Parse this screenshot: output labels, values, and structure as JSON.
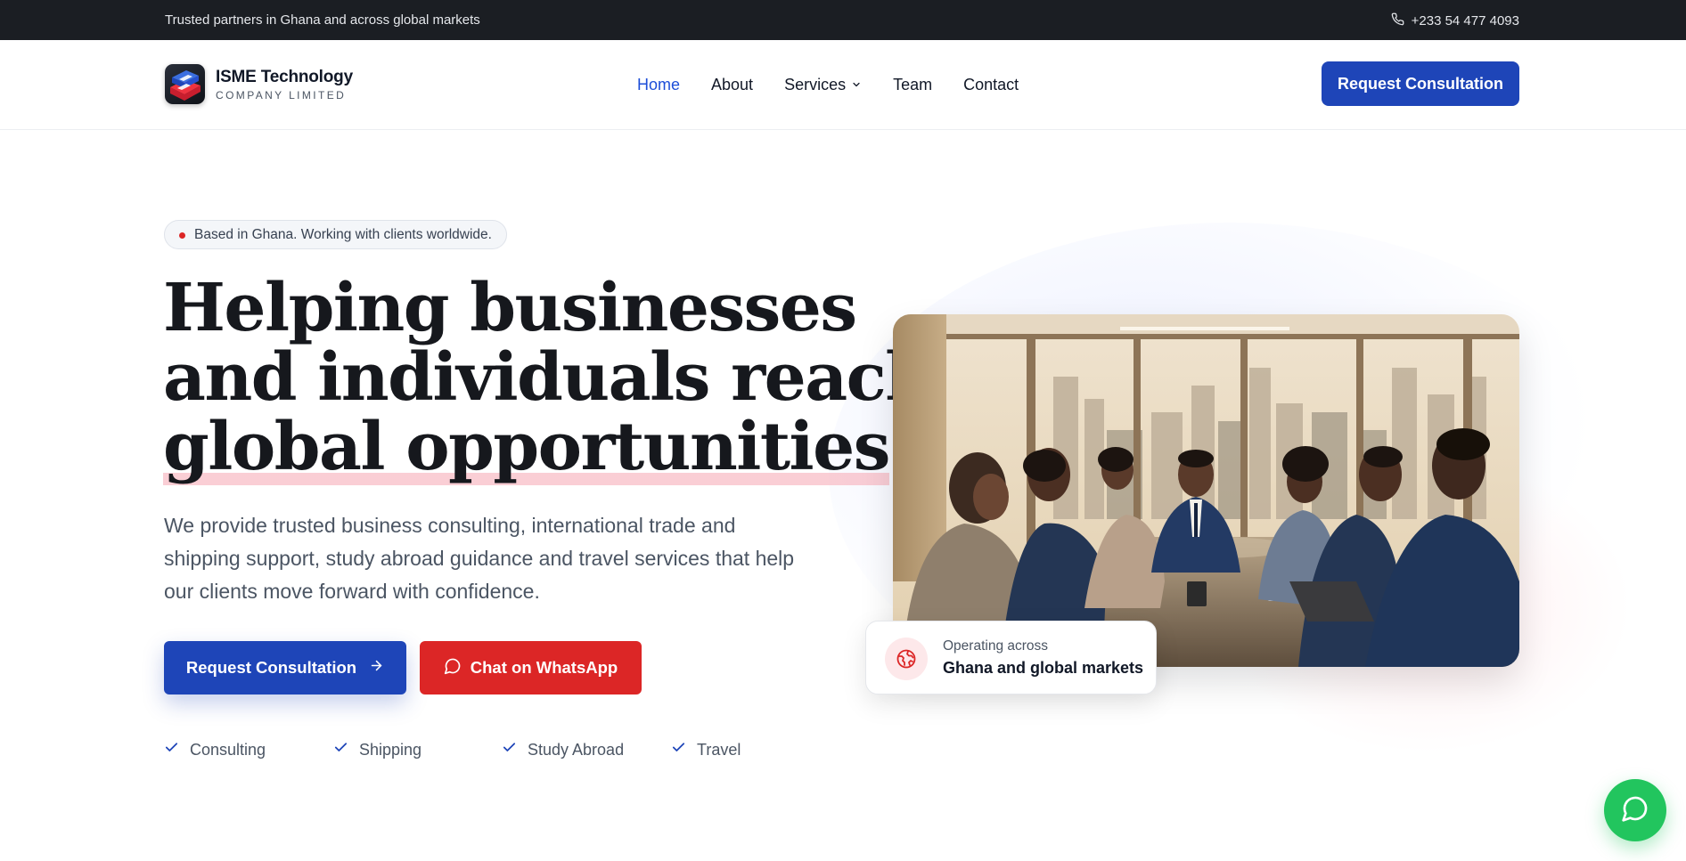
{
  "topbar": {
    "tagline": "Trusted partners in Ghana and across global markets",
    "phone": "+233 54 477 4093",
    "phone_icon": "phone-icon"
  },
  "brand": {
    "name": "ISME Technology",
    "subtitle": "COMPANY LIMITED",
    "logo_icon": "isme-logo-icon"
  },
  "nav": {
    "items": [
      {
        "label": "Home",
        "active": true
      },
      {
        "label": "About",
        "active": false
      },
      {
        "label": "Services",
        "active": false,
        "has_dropdown": true
      },
      {
        "label": "Team",
        "active": false
      },
      {
        "label": "Contact",
        "active": false
      }
    ],
    "cta": "Request Consultation"
  },
  "hero": {
    "pill": "Based in Ghana. Working with clients worldwide.",
    "headline_lines": [
      "Helping businesses",
      "and individuals reach",
      "global opportunities"
    ],
    "lede": "We provide trusted business consulting, international trade and shipping support, study abroad guidance and travel services that help our clients move forward with confidence.",
    "primary_cta": "Request Consultation",
    "secondary_cta": "Chat on WhatsApp",
    "features": [
      "Consulting",
      "Shipping",
      "Study Abroad",
      "Travel"
    ],
    "image_icon": "business-meeting-photo"
  },
  "badge": {
    "small": "Operating across",
    "big": "Ghana and global markets",
    "icon": "globe-icon"
  },
  "fab": {
    "icon": "whatsapp-chat-icon"
  },
  "colors": {
    "primary": "#1e45b8",
    "accent_red": "#dc2626",
    "whatsapp_green": "#22c55e",
    "topbar_bg": "#1b1e23",
    "nav_active": "#1d4ed8"
  }
}
